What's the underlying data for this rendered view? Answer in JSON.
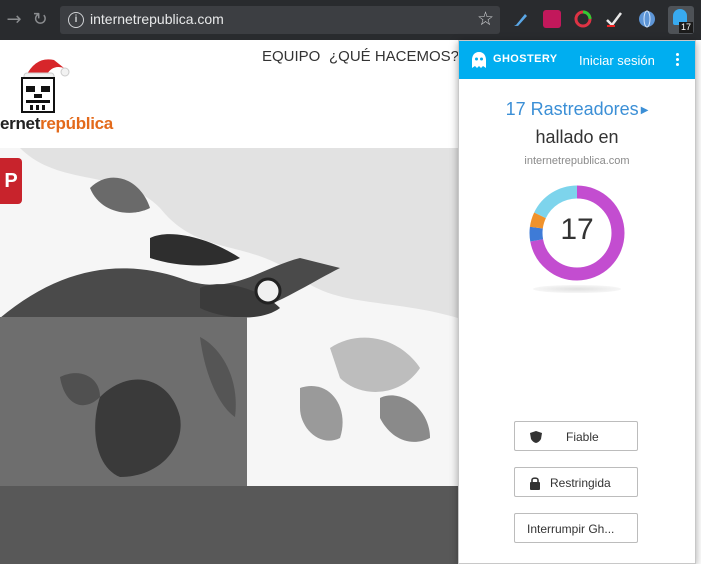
{
  "browser": {
    "url": "internetrepublica.com",
    "ghostery_badge": "17",
    "nav_icons": [
      "back-arrow-icon",
      "reload-icon",
      "info-icon",
      "star-icon"
    ]
  },
  "site": {
    "logo_prefix": "ernet",
    "logo_suffix": "república",
    "nav": [
      "EQUIPO",
      "¿QUÉ HACEMOS?"
    ],
    "pinterest_label": "P"
  },
  "popup": {
    "brand": "GHOSTERY",
    "signin": "Iniciar sesión",
    "tracker_count": "17 Rastreadores",
    "found_in": "hallado en",
    "domain": "internetrepublica.com",
    "donut_number": "17",
    "donut_fractions": [
      {
        "color": "#c34dd0",
        "value": 0.72
      },
      {
        "color": "#3e7bd7",
        "value": 0.05
      },
      {
        "color": "#f0922b",
        "value": 0.05
      },
      {
        "color": "#7dd4ec",
        "value": 0.18
      }
    ],
    "buttons": {
      "trust": "Fiable",
      "restrict": "Restringida",
      "pause": "Interrumpir Gh..."
    }
  },
  "colors": {
    "ghostery_blue": "#00aef0",
    "link_blue": "#3b8fd6",
    "toolbar": "#292b2e"
  }
}
